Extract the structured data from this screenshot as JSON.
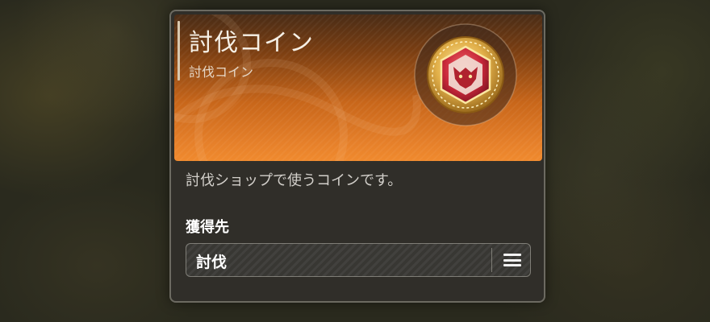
{
  "item": {
    "title": "討伐コイン",
    "subtitle": "討伐コイン",
    "description": "討伐ショップで使うコインです。",
    "icon": "subjugation-coin-icon"
  },
  "acquisition": {
    "heading": "獲得先",
    "sources": [
      {
        "label": "討伐",
        "action_icon": "menu-icon"
      }
    ]
  },
  "colors": {
    "banner_orange": "#e6802a",
    "coin_gold": "#e2b04a",
    "coin_red": "#c8283a",
    "card_bg": "#302e2a"
  }
}
